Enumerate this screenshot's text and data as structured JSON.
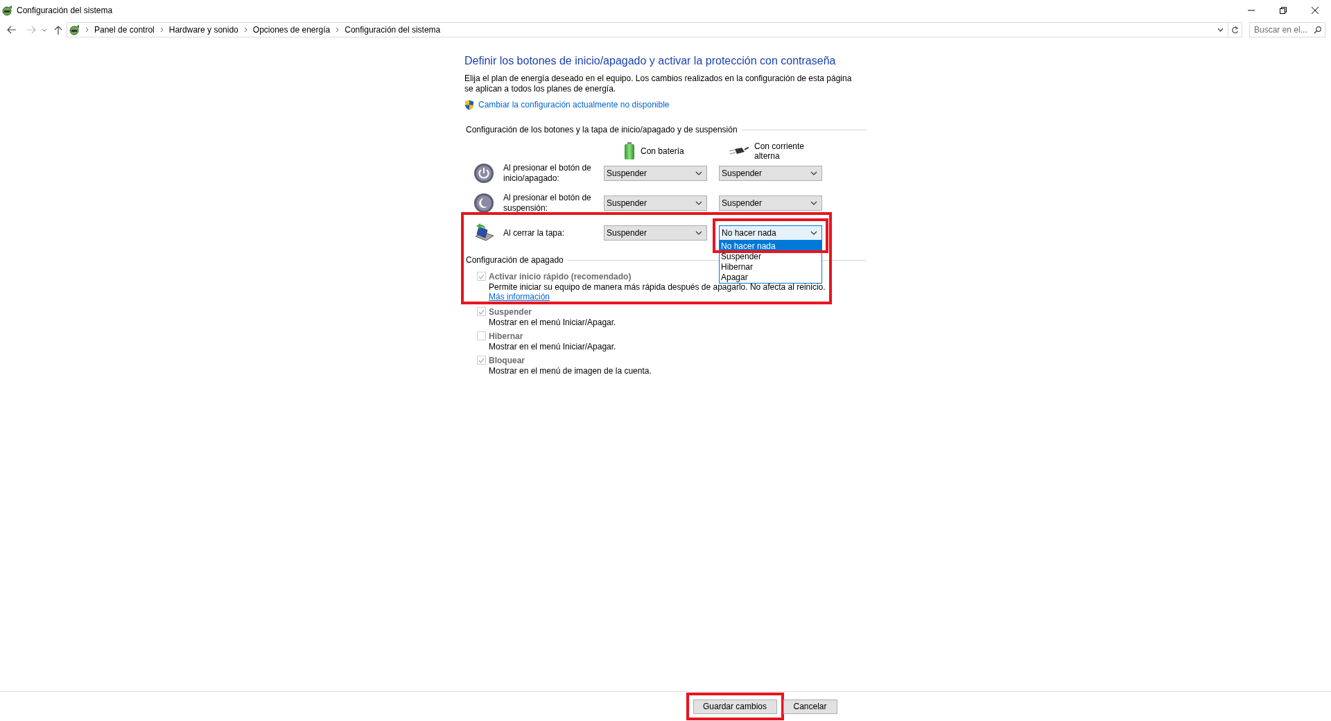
{
  "window": {
    "title": "Configuración del sistema"
  },
  "address_bar": {
    "breadcrumbs": [
      "Panel de control",
      "Hardware y sonido",
      "Opciones de energía",
      "Configuración del sistema"
    ]
  },
  "search": {
    "placeholder": "Buscar en el..."
  },
  "heading": "Definir los botones de inicio/apagado y activar la protección con contraseña",
  "description": "Elija el plan de energía deseado en el equipo. Los cambios realizados en la configuración de esta página se aplican a todos los planes de energía.",
  "admin_link": "Cambiar la configuración actualmente no disponible",
  "buttons_section": {
    "title": "Configuración de los botones y la tapa de inicio/apagado y de suspensión",
    "columns": [
      {
        "kind": "battery",
        "label": "Con batería"
      },
      {
        "kind": "plug",
        "label": "Con corriente alterna"
      }
    ],
    "rows": [
      {
        "kind": "power",
        "label": "Al presionar el botón de inicio/apagado:",
        "highlighted": false,
        "values": [
          {
            "value": "Suspender",
            "open": false,
            "highlighted": false
          },
          {
            "value": "Suspender",
            "open": false,
            "highlighted": false
          }
        ]
      },
      {
        "kind": "sleep",
        "label": "Al presionar el botón de suspensión:",
        "highlighted": false,
        "values": [
          {
            "value": "Suspender",
            "open": false,
            "highlighted": false
          },
          {
            "value": "Suspender",
            "open": false,
            "highlighted": false
          }
        ]
      },
      {
        "kind": "lid",
        "label": "Al cerrar la tapa:",
        "highlighted": true,
        "values": [
          {
            "value": "Suspender",
            "open": false,
            "highlighted": false
          },
          {
            "value": "No hacer nada",
            "open": true,
            "highlighted": true,
            "options": [
              {
                "label": "No hacer nada",
                "selected": true
              },
              {
                "label": "Suspender",
                "selected": false
              },
              {
                "label": "Hibernar",
                "selected": false
              },
              {
                "label": "Apagar",
                "selected": false
              }
            ]
          }
        ]
      }
    ]
  },
  "shutdown_section": {
    "title": "Configuración de apagado",
    "options": [
      {
        "label": "Activar inicio rápido (recomendado)",
        "checked": true,
        "disabled": true,
        "description": "Permite iniciar su equipo de manera más rápida después de apagarlo. No afecta al reinicio.",
        "link": "Más información"
      },
      {
        "label": "Suspender",
        "checked": true,
        "disabled": true,
        "description": "Mostrar en el menú Iniciar/Apagar."
      },
      {
        "label": "Hibernar",
        "checked": false,
        "disabled": true,
        "description": "Mostrar en el menú Iniciar/Apagar."
      },
      {
        "label": "Bloquear",
        "checked": true,
        "disabled": true,
        "description": "Mostrar en el menú de imagen de la cuenta."
      }
    ]
  },
  "footer_buttons": [
    {
      "label": "Guardar cambios",
      "highlighted": true
    },
    {
      "label": "Cancelar",
      "highlighted": false
    }
  ]
}
